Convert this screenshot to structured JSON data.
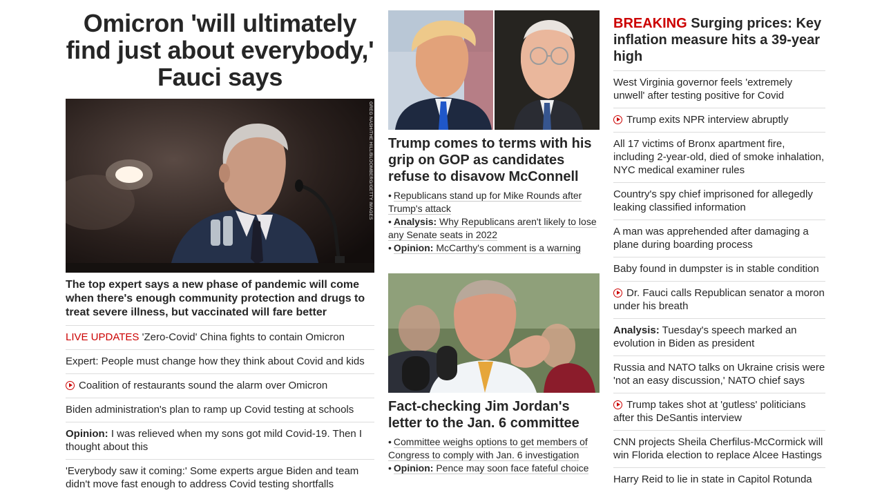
{
  "left": {
    "headline": "Omicron 'will ultimately find just about everybody,' Fauci says",
    "photo_credit": "GREG NASH/THE HILL/BLOOMBERG/GETTY IMAGES",
    "subhead": "The top expert says a new phase of pandemic will come when there's enough community protection and drugs to treat severe illness, but vaccinated will fare better",
    "items": [
      {
        "prefix": "LIVE UPDATES",
        "text": "'Zero-Covid' China fights to contain Omicron"
      },
      {
        "text": "Expert: People must change how they think about Covid and kids"
      },
      {
        "video": true,
        "text": "Coalition of restaurants sound the alarm over Omicron"
      },
      {
        "text": "Biden administration's plan to ramp up Covid testing at schools"
      },
      {
        "bold": "Opinion:",
        "text": "I was relieved when my sons got mild Covid-19. Then I thought about this"
      },
      {
        "text": "'Everybody saw it coming:' Some experts argue Biden and team didn't move fast enough to address Covid testing shortfalls"
      }
    ]
  },
  "middle": {
    "story1": {
      "title": "Trump comes to terms with his grip on GOP as candidates refuse to disavow McConnell",
      "bullets": [
        {
          "text": "Republicans stand up for Mike Rounds after Trump's attack"
        },
        {
          "bold": "Analysis:",
          "text": "Why Republicans aren't likely to lose any Senate seats in 2022"
        },
        {
          "bold": "Opinion:",
          "text": "McCarthy's comment is a warning"
        }
      ]
    },
    "story2": {
      "title": "Fact-checking Jim Jordan's letter to the Jan. 6 committee",
      "bullets": [
        {
          "text": "Committee weighs options to get members of Congress to comply with Jan. 6 investigation"
        },
        {
          "bold": "Opinion:",
          "text": "Pence may soon face fateful choice"
        }
      ]
    }
  },
  "right": {
    "breaking_label": "BREAKING",
    "breaking_headline": "Surging prices: Key inflation measure hits a 39-year high",
    "items": [
      {
        "text": "West Virginia governor feels 'extremely unwell' after testing positive for Covid"
      },
      {
        "video": true,
        "text": "Trump exits NPR interview abruptly"
      },
      {
        "text": "All 17 victims of Bronx apartment fire, including 2-year-old, died of smoke inhalation, NYC medical examiner rules"
      },
      {
        "text": "Country's spy chief imprisoned for allegedly leaking classified information"
      },
      {
        "text": "A man was apprehended after damaging a plane during boarding process"
      },
      {
        "text": "Baby found in dumpster is in stable condition"
      },
      {
        "video": true,
        "text": "Dr. Fauci calls Republican senator a moron under his breath"
      },
      {
        "bold": "Analysis:",
        "text": "Tuesday's speech marked an evolution in Biden as president"
      },
      {
        "text": "Russia and NATO talks on Ukraine crisis were 'not an easy discussion,' NATO chief says"
      },
      {
        "video": true,
        "text": "Trump takes shot at 'gutless' politicians after this DeSantis interview"
      },
      {
        "text": "CNN projects Sheila Cherfilus-McCormick will win Florida election to replace Alcee Hastings"
      },
      {
        "text": "Harry Reid to lie in state in Capitol Rotunda"
      }
    ]
  },
  "colors": {
    "accent": "#cc0000",
    "text": "#262626",
    "divider": "#dcdcdc"
  },
  "icons": {
    "video": "play-circle-icon"
  }
}
